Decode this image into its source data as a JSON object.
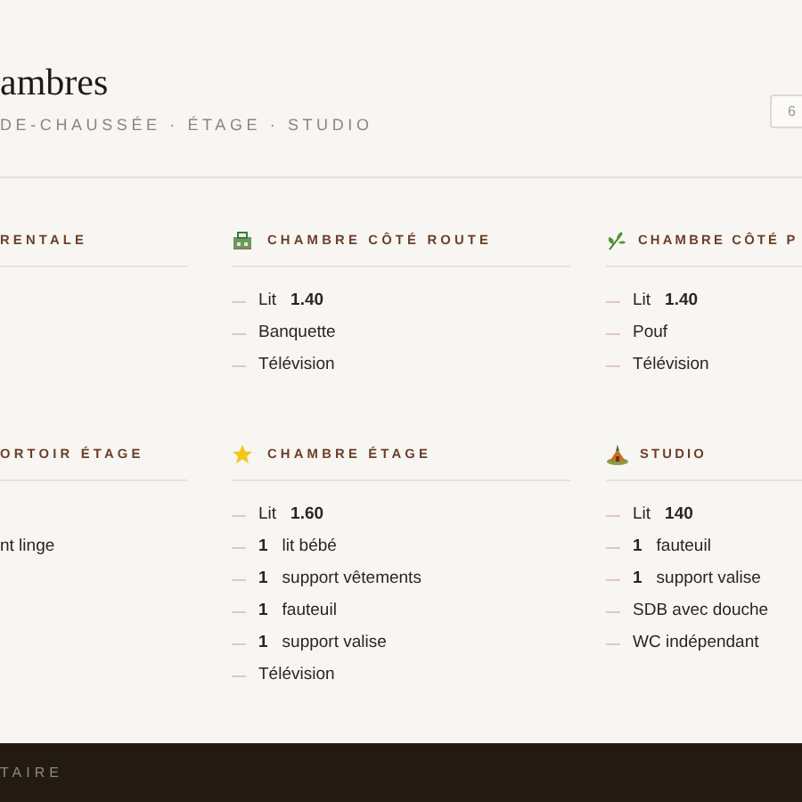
{
  "header": {
    "title": "ambres",
    "subtitle": "DE-CHAUSSÉE · ÉTAGE · STUDIO",
    "counter": "6"
  },
  "rooms": [
    {
      "name": "RENTALE"
    },
    {
      "name": "CHAMBRE CÔTÉ ROUTE",
      "items": [
        {
          "kind": "size",
          "label": "Lit",
          "value": "1.40"
        },
        {
          "kind": "plain",
          "label": "Banquette"
        },
        {
          "kind": "plain",
          "label": "Télévision"
        }
      ]
    },
    {
      "name": "CHAMBRE CÔTÉ P",
      "items": [
        {
          "kind": "size",
          "label": "Lit",
          "value": "1.40"
        },
        {
          "kind": "plain",
          "label": "Pouf"
        },
        {
          "kind": "plain",
          "label": "Télévision"
        }
      ]
    },
    {
      "name": "ORTOIR ÉTAGE",
      "items": [
        {
          "kind": "plain",
          "label": "nt linge"
        }
      ]
    },
    {
      "name": "CHAMBRE ÉTAGE",
      "items": [
        {
          "kind": "size",
          "label": "Lit",
          "value": "1.60"
        },
        {
          "kind": "count",
          "value": "1",
          "label": "lit bébé"
        },
        {
          "kind": "count",
          "value": "1",
          "label": "support vêtements"
        },
        {
          "kind": "count",
          "value": "1",
          "label": "fauteuil"
        },
        {
          "kind": "count",
          "value": "1",
          "label": "support valise"
        },
        {
          "kind": "plain",
          "label": "Télévision"
        }
      ]
    },
    {
      "name": "STUDIO",
      "items": [
        {
          "kind": "size",
          "label": "Lit",
          "value": "140"
        },
        {
          "kind": "count",
          "value": "1",
          "label": "fauteuil"
        },
        {
          "kind": "count",
          "value": "1",
          "label": "support valise"
        },
        {
          "kind": "plain",
          "label": "SDB avec douche"
        },
        {
          "kind": "plain",
          "label": "WC indépendant"
        }
      ]
    }
  ],
  "footer": {
    "text": "TAIRE"
  }
}
